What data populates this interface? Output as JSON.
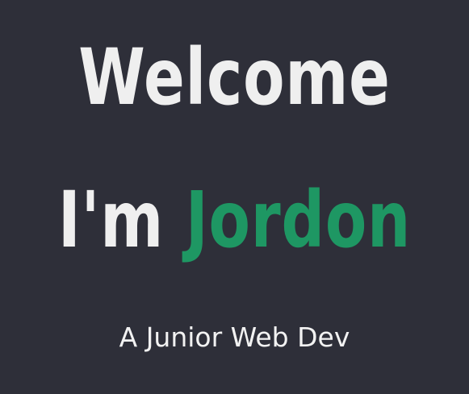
{
  "hero": {
    "heading_line1": "Welcome",
    "heading_prefix": "I'm",
    "heading_name": "Jordon",
    "subtitle": "A Junior Web Dev"
  },
  "colors": {
    "background": "#2e2f39",
    "text": "#efefef",
    "accent": "#1e9763"
  }
}
